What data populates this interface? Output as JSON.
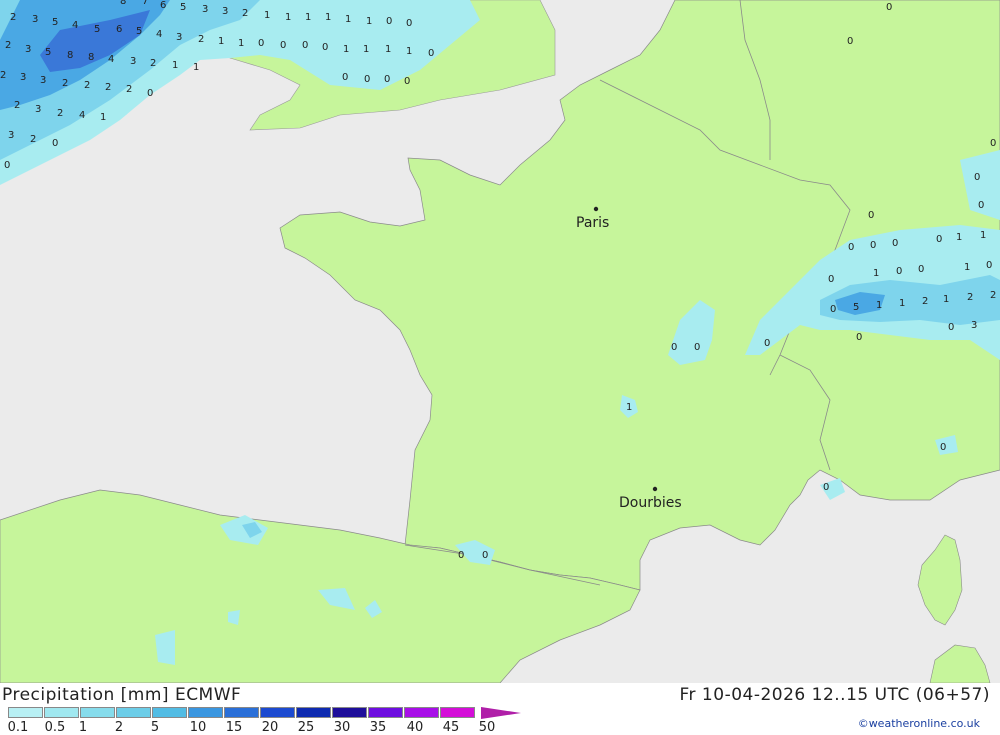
{
  "map": {
    "cities": [
      {
        "name": "Paris"
      },
      {
        "name": "Dourbies"
      }
    ],
    "colors": {
      "sea": "#ebebeb",
      "land": "#c6f59b",
      "precip_light": "#a8ecf0",
      "precip_mid": "#7ed4ec",
      "precip_heavy": "#4aa8e4",
      "border": "#8a8a8a"
    }
  },
  "footer": {
    "title": "Precipitation [mm] ECMWF",
    "datetime": "Fr 10-04-2026 12..15 UTC (06+57)",
    "credit": "©weatheronline.co.uk",
    "legend": {
      "ticks": [
        "0.1",
        "0.5",
        "1",
        "2",
        "5",
        "10",
        "15",
        "20",
        "25",
        "30",
        "35",
        "40",
        "45",
        "50"
      ],
      "colors": [
        "#b8f0f4",
        "#a0e8f0",
        "#86dcec",
        "#6ccde8",
        "#52bce4",
        "#3a96e0",
        "#2a6fd8",
        "#1c4ad0",
        "#0e2ab0",
        "#1e0e9a",
        "#6e0ee0",
        "#a80ee8",
        "#d40ed8"
      ]
    }
  }
}
